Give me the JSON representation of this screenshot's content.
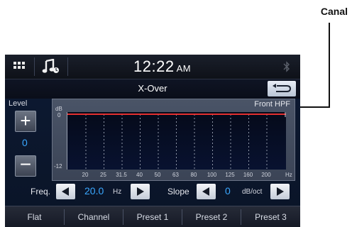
{
  "callout": {
    "label": "Canal"
  },
  "status": {
    "time": "12:22",
    "ampm": "AM"
  },
  "title": "X-Over",
  "level": {
    "label": "Level",
    "value": "0"
  },
  "graph": {
    "channel": "Front HPF",
    "y_unit": "dB",
    "y_top": "0",
    "y_bottom": "-12",
    "x_unit": "Hz",
    "freq_ticks": [
      "20",
      "25",
      "31.5",
      "40",
      "50",
      "63",
      "80",
      "100",
      "125",
      "160",
      "200"
    ],
    "cutoff_db": 0,
    "line_color": "#e53030"
  },
  "freq": {
    "label": "Freq.",
    "value": "20.0",
    "unit": "Hz"
  },
  "slope": {
    "label": "Slope",
    "value": "0",
    "unit": "dB/oct"
  },
  "tabs": [
    "Flat",
    "Channel",
    "Preset 1",
    "Preset 2",
    "Preset 3"
  ],
  "icons": {
    "menu": "grid-menu-icon",
    "music": "music-source-icon",
    "back": "back-arrow-icon",
    "bluetooth": "bluetooth-icon"
  }
}
